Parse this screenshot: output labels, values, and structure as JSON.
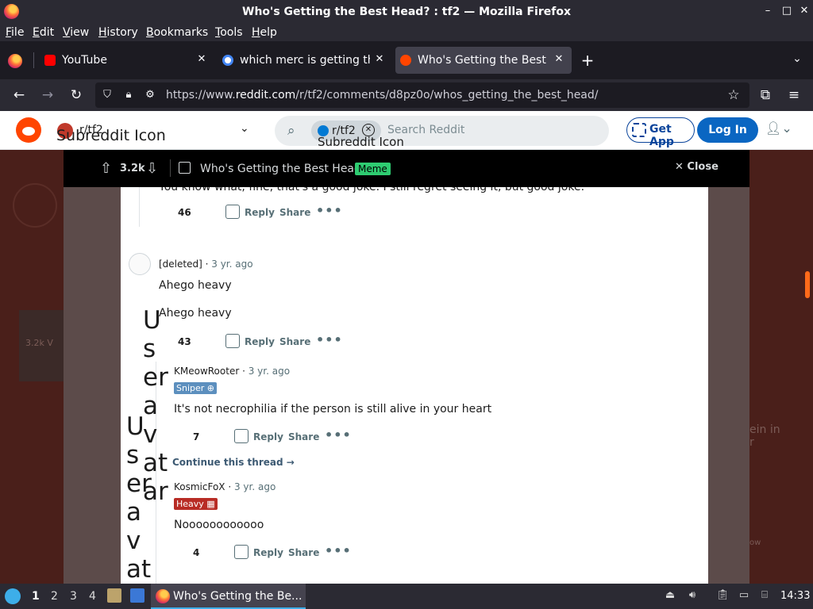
{
  "window": {
    "title": "Who's Getting the Best Head? : tf2 — Mozilla Firefox",
    "minimize_glyph": "–",
    "maximize_glyph": "□",
    "close_glyph": "✕"
  },
  "menubar": [
    "File",
    "Edit",
    "View",
    "History",
    "Bookmarks",
    "Tools",
    "Help"
  ],
  "tabs": [
    {
      "label": "YouTube",
      "icon": "youtube-icon",
      "color": "#ff0000",
      "active": false
    },
    {
      "label": "which merc is getting the",
      "icon": "google-icon",
      "color": "#4285f4",
      "active": false
    },
    {
      "label": "Who's Getting the Best H",
      "icon": "reddit-icon",
      "color": "#ff4500",
      "active": true
    }
  ],
  "tab_close_glyph": "✕",
  "new_tab_glyph": "+",
  "list_tabs_glyph": "⌄",
  "nav": {
    "back_glyph": "←",
    "forward_glyph": "→",
    "reload_glyph": "↻",
    "url_prefix": "https://www.",
    "url_domain": "reddit.com",
    "url_path": "/r/tf2/comments/d8pz0o/whos_getting_the_best_head/",
    "bookmark_glyph": "☆",
    "extensions_glyph": "⧉",
    "menu_glyph": "≡"
  },
  "reddit_header": {
    "subreddit": "r/tf2",
    "subreddit_icon_alt": "Subreddit Icon",
    "search_chip": "r/tf2",
    "search_chip_alt": "Subreddit Icon",
    "search_placeholder": "Search Reddit",
    "get_app": "Get App",
    "login": "Log In"
  },
  "post_bar": {
    "score": "3.2k",
    "title": "Who's Getting the Best Head?",
    "flair": "Meme",
    "close": "Close"
  },
  "background": {
    "left_score": "3.2k",
    "left_text": "V",
    "right_text": "ein in",
    "right_text2": "r",
    "right_text3": "ow"
  },
  "comments": {
    "partial_text": "You know what, fine, that's a good joke. I still regret seeing it, but good joke.",
    "partial_votes": "46",
    "deleted_user": "[deleted]",
    "deleted_age": "3 yr. ago",
    "deleted_body": "Ahego heavy",
    "deleted_body_alt": "Ahego heavy",
    "deleted_votes": "43",
    "reply1_user": "KMeowRooter",
    "reply1_age": "3 yr. ago",
    "reply1_flair": "Sniper",
    "reply1_body": "It's not necrophilia if the person is still alive in your heart",
    "reply1_votes": "7",
    "continue_thread": "Continue this thread →",
    "reply2_user": "KosmicFoX",
    "reply2_age": "3 yr. ago",
    "reply2_flair": "Heavy",
    "reply2_body": "Noooooooooooo",
    "reply2_votes": "4",
    "reply_label": "Reply",
    "share_label": "Share",
    "more_glyph": "•••",
    "user_avatar_alt": "User avatar"
  },
  "taskbar": {
    "workspaces": [
      "1",
      "2",
      "3",
      "4"
    ],
    "active_task": "Who's Getting the Be...",
    "clock": "14:33"
  },
  "colors": {
    "reddit_orange": "#ff4500",
    "login_blue": "#0a66c2",
    "meme_flair": "#2ecc71",
    "sniper_flair": "#5c8fbe",
    "heavy_flair": "#b82c25"
  }
}
